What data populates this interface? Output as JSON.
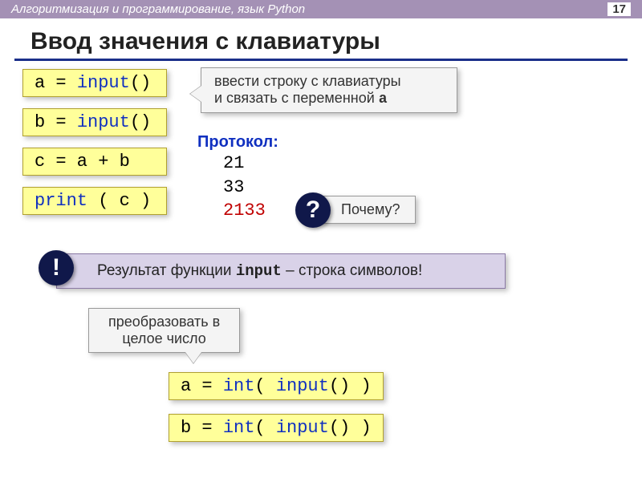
{
  "header": {
    "breadcrumb": "Алгоритмизация и программирование, язык Python",
    "page_number": "17"
  },
  "title": "Ввод значения с клавиатуры",
  "code_stack": {
    "line1_a": "a",
    "line1_eq": " = ",
    "line1_fn": "input",
    "line1_rest": "()",
    "line2_a": "b",
    "line2_eq": " = ",
    "line2_fn": "input",
    "line2_rest": "()",
    "line3": "c = a + b",
    "line4_fn": "print",
    "line4_rest": " ( c )"
  },
  "callout_input": {
    "line1": "ввести строку с клавиатуры",
    "line2_pre": "и связать с переменной ",
    "line2_var": "a"
  },
  "protocol": {
    "label": "Протокол:",
    "in1": "21",
    "in2": "33",
    "out": "2133"
  },
  "question": {
    "mark": "?",
    "text": "Почему?"
  },
  "result": {
    "mark": "!",
    "pre": "Результат функции ",
    "mono": "input",
    "post": " – строка символов!"
  },
  "callout_convert": {
    "line1": "преобразовать в",
    "line2": "целое число"
  },
  "int_boxes": {
    "a_var": "a",
    "eq": " = ",
    "int_kw": "int",
    "open": "( ",
    "input_kw": "input",
    "rest": "() )",
    "b_var": "b"
  }
}
